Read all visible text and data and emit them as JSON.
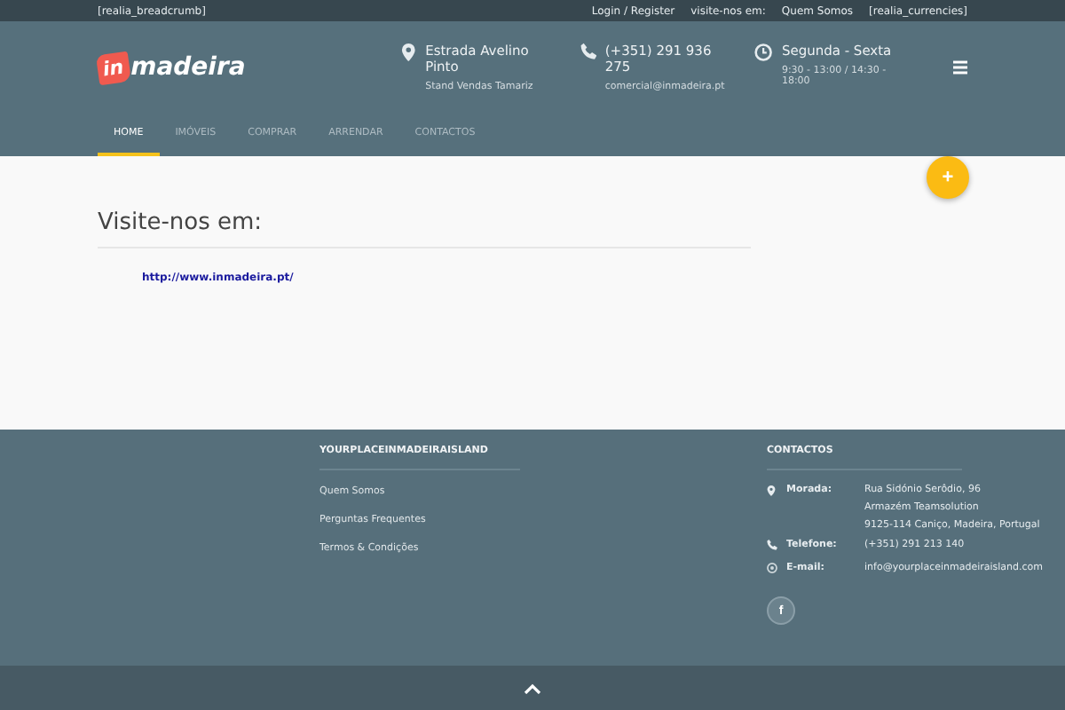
{
  "topbar": {
    "breadcrumb": "[realia_breadcrumb]",
    "links": [
      "Login / Register",
      "visite-nos em:",
      "Quem Somos",
      "[realia_currencies]"
    ]
  },
  "header": {
    "logo": {
      "badge": "in",
      "text": "madeira"
    },
    "contacts": [
      {
        "kind": "location",
        "title": "Estrada Avelino Pinto",
        "subtitle": "Stand Vendas Tamariz"
      },
      {
        "kind": "phone",
        "title": "(+351) 291 936 275",
        "subtitle": "comercial@inmadeira.pt"
      },
      {
        "kind": "clock",
        "title": "Segunda - Sexta",
        "subtitle": "9:30 - 13:00 / 14:30 - 18:00"
      }
    ]
  },
  "nav": [
    {
      "label": "HOME",
      "selected": true
    },
    {
      "label": "IMÓVEIS",
      "selected": false
    },
    {
      "label": "COMPRAR",
      "selected": false
    },
    {
      "label": "ARRENDAR",
      "selected": false
    },
    {
      "label": "CONTACTOS",
      "selected": false
    }
  ],
  "fab": "+",
  "content": {
    "title": "Visite-nos em:",
    "link": "http://www.inmadeira.pt/"
  },
  "footer": {
    "col1": {
      "title": "YOURPLACEINMADEIRAISLAND",
      "links": [
        "Quem Somos",
        "Perguntas Frequentes",
        "Termos & Condições"
      ]
    },
    "col2": {
      "title": "CONTACTOS",
      "rows": [
        {
          "kind": "location",
          "label": "Morada:",
          "lines": [
            "Rua Sidónio Serôdio, 96",
            "Armazém Teamsolution",
            "9125-114 Caniço, Madeira, Portugal"
          ]
        },
        {
          "kind": "phone",
          "label": "Telefone:",
          "lines": [
            "(+351) 291 213 140"
          ]
        },
        {
          "kind": "email",
          "label": "E-mail:",
          "lines": [
            "info@yourplaceinmadeiraisland.com"
          ]
        }
      ],
      "social": "f"
    }
  }
}
